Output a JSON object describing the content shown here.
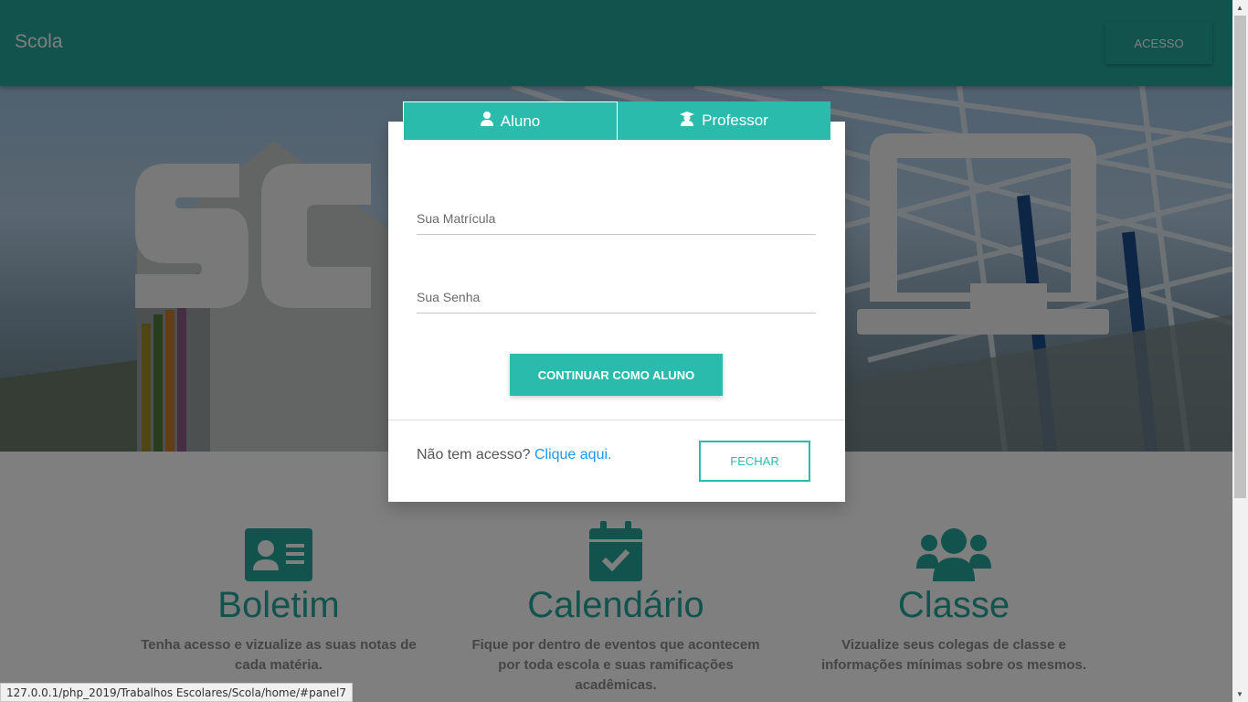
{
  "navbar": {
    "brand": "Scola",
    "access_button": "ACESSO",
    "color": "#26a69a"
  },
  "hero": {
    "logo_text": "SC"
  },
  "modal": {
    "tabs": [
      {
        "label": "Aluno",
        "icon": "user-icon"
      },
      {
        "label": "Professor",
        "icon": "graduation-user-icon"
      }
    ],
    "fields": {
      "matricula": {
        "label": "Sua Matrícula",
        "value": ""
      },
      "senha": {
        "label": "Sua Senha",
        "value": ""
      }
    },
    "continue_button": "CONTINUAR COMO ALUNO",
    "no_access_text": "Não tem acesso?",
    "no_access_link": "Clique aqui.",
    "close_button": "FECHAR"
  },
  "features": [
    {
      "icon": "id-card-icon",
      "title": "Boletim",
      "description": "Tenha acesso e vizualize as suas notas de cada matéria."
    },
    {
      "icon": "calendar-check-icon",
      "title": "Calendário",
      "description": "Fique por dentro de eventos que acontecem por toda escola e suas ramificações acadêmicas."
    },
    {
      "icon": "users-icon",
      "title": "Classe",
      "description": "Vizualize seus colegas de classe e informações mínimas sobre os mesmos."
    }
  ],
  "statusbar": {
    "url": "127.0.0.1/php_2019/Trabalhos Escolares/Scola/home/#panel7"
  },
  "colors": {
    "accent": "#2bbbad",
    "link": "#2196f3"
  }
}
